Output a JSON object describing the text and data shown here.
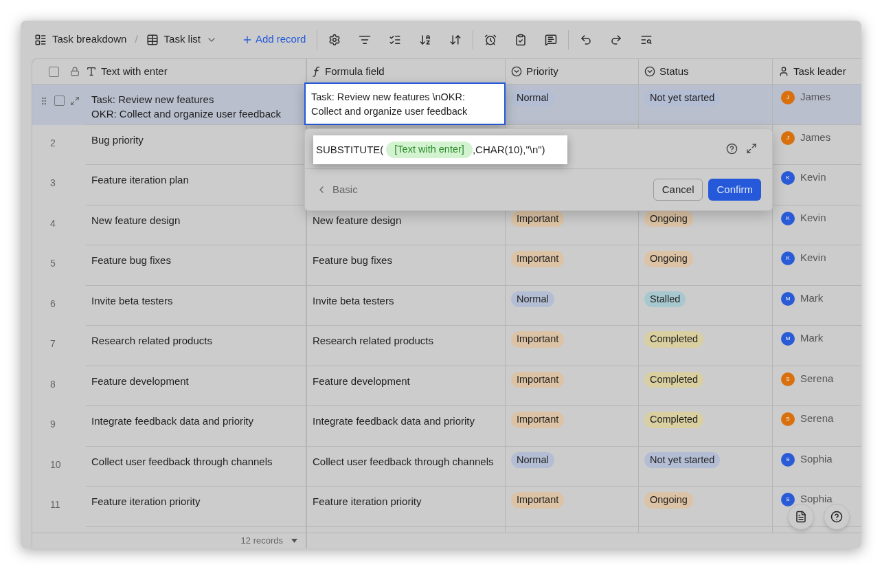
{
  "toolbar": {
    "breadcrumb": "Task breakdown",
    "separator": "/",
    "view": "Task list",
    "add_record": "Add record"
  },
  "select_all": {
    "checked": false
  },
  "columns": [
    {
      "label": "Text with enter",
      "kind": "text"
    },
    {
      "label": "Formula field",
      "kind": "formula"
    },
    {
      "label": "Priority",
      "kind": "select"
    },
    {
      "label": "Status",
      "kind": "select"
    },
    {
      "label": "Task leader",
      "kind": "person"
    }
  ],
  "rows": [
    {
      "selected": true,
      "checked": false,
      "text": [
        "Task: Review new features",
        "OKR: Collect and organize user feedback"
      ],
      "formula": "Task: Review new features \\nOKR: Collect and organize user feedback",
      "priority": {
        "label": "Normal",
        "color": "#b3bdd3"
      },
      "status": {
        "label": "Not yet started",
        "color": "#b3bdd3"
      },
      "leader": {
        "initial": "J",
        "name": "James",
        "color": "#d9700e"
      }
    },
    {
      "selected": false,
      "number": "2",
      "text": [
        "Bug priority"
      ],
      "leader": {
        "initial": "J",
        "name": "James",
        "color": "#d9700e"
      }
    },
    {
      "selected": false,
      "number": "3",
      "text": [
        "Feature iteration plan"
      ],
      "leader": {
        "initial": "K",
        "name": "Kevin",
        "color": "#2a5bd7"
      }
    },
    {
      "selected": false,
      "number": "4",
      "text": [
        "New feature design"
      ],
      "formula": "New feature design",
      "priority": {
        "label": "Important",
        "color": "#dcc3a5"
      },
      "status": {
        "label": "Ongoing",
        "color": "#dcc3a5"
      },
      "leader": {
        "initial": "K",
        "name": "Kevin",
        "color": "#2a5bd7"
      }
    },
    {
      "selected": false,
      "number": "5",
      "text": [
        "Feature bug fixes"
      ],
      "formula": "Feature bug fixes",
      "priority": {
        "label": "Important",
        "color": "#dcc3a5"
      },
      "status": {
        "label": "Ongoing",
        "color": "#dcc3a5"
      },
      "leader": {
        "initial": "K",
        "name": "Kevin",
        "color": "#2a5bd7"
      }
    },
    {
      "selected": false,
      "number": "6",
      "text": [
        "Invite beta testers"
      ],
      "formula": "Invite beta testers",
      "priority": {
        "label": "Normal",
        "color": "#b3bdd3"
      },
      "status": {
        "label": "Stalled",
        "color": "#a8c8d0"
      },
      "leader": {
        "initial": "M",
        "name": "Mark",
        "color": "#2a5bd7"
      }
    },
    {
      "selected": false,
      "number": "7",
      "text": [
        "Research related products"
      ],
      "formula": "Research related products",
      "priority": {
        "label": "Important",
        "color": "#dcc3a5"
      },
      "status": {
        "label": "Completed",
        "color": "#d9cfa0"
      },
      "leader": {
        "initial": "M",
        "name": "Mark",
        "color": "#2a5bd7"
      }
    },
    {
      "selected": false,
      "number": "8",
      "text": [
        "Feature development"
      ],
      "formula": "Feature development",
      "priority": {
        "label": "Important",
        "color": "#dcc3a5"
      },
      "status": {
        "label": "Completed",
        "color": "#d9cfa0"
      },
      "leader": {
        "initial": "S",
        "name": "Serena",
        "color": "#d9700e"
      }
    },
    {
      "selected": false,
      "number": "9",
      "text": [
        "Integrate feedback data and priority"
      ],
      "formula": "Integrate feedback data and priority",
      "priority": {
        "label": "Important",
        "color": "#dcc3a5"
      },
      "status": {
        "label": "Completed",
        "color": "#d9cfa0"
      },
      "leader": {
        "initial": "S",
        "name": "Serena",
        "color": "#d9700e"
      }
    },
    {
      "selected": false,
      "number": "10",
      "text": [
        "Collect user feedback through channels"
      ],
      "formula": "Collect user feedback through channels",
      "priority": {
        "label": "Normal",
        "color": "#b3bdd3"
      },
      "status": {
        "label": "Not yet started",
        "color": "#b3bdd3"
      },
      "leader": {
        "initial": "S",
        "name": "Sophia",
        "color": "#2a5bd7"
      }
    },
    {
      "selected": false,
      "number": "11",
      "text": [
        "Feature iteration priority"
      ],
      "formula": "Feature iteration priority",
      "priority": {
        "label": "Important",
        "color": "#dcc3a5"
      },
      "status": {
        "label": "Ongoing",
        "color": "#dcc3a5"
      },
      "leader": {
        "initial": "S",
        "name": "Sophia",
        "color": "#2a5bd7"
      }
    }
  ],
  "footer": {
    "count": "12 records"
  },
  "formula_editor": {
    "prefix": "SUBSTITUTE(",
    "field": "[Text with enter]",
    "suffix": ",CHAR(10),\"\\n\")",
    "back": "Basic",
    "cancel": "Cancel",
    "confirm": "Confirm"
  }
}
